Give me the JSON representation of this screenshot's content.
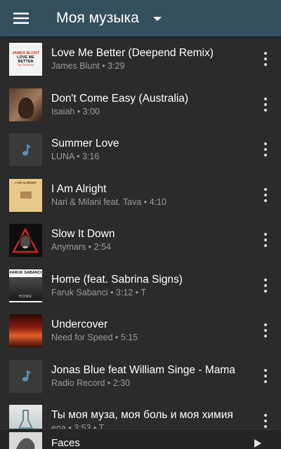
{
  "header": {
    "title": "Моя музыка",
    "menu_icon": "hamburger-menu-icon",
    "dropdown_icon": "caret-down-icon"
  },
  "colors": {
    "toolbar": "#34505f",
    "background": "#2b2b2b",
    "subtitle": "#9a9a9a"
  },
  "tracks": [
    {
      "title": "Love Me Better (Deepend Remix)",
      "subtitle": "James Blunt • 3:29",
      "cover_lines": [
        "JAMES BLUNT",
        "LOVE ME BETTER",
        "THE REMIXES"
      ]
    },
    {
      "title": "Don't Come Easy (Australia)",
      "subtitle": "Isaiah • 3:00"
    },
    {
      "title": "Summer Love",
      "subtitle": "LUNA • 3:16",
      "cover_icon": "music-note-icon"
    },
    {
      "title": "I Am Alright",
      "subtitle": "Nari & Milani feat. Tava  • 4:10",
      "cover_lines": [
        "I AM ALRIGHT"
      ]
    },
    {
      "title": "Slow It Down",
      "subtitle": "Anymars • 2:54"
    },
    {
      "title": "Home (feat. Sabrina Signs)",
      "subtitle": "Faruk Sabanci • 3:12 • T",
      "cover_lines": [
        "FARUK SABANCI",
        "HOME"
      ]
    },
    {
      "title": "Undercover",
      "subtitle": "Need for Speed • 5:15"
    },
    {
      "title": "Jonas Blue feat William Singe - Mama",
      "subtitle": "Radio Record • 2:30",
      "cover_icon": "music-note-icon"
    },
    {
      "title": "Ты моя муза, моя боль и моя химия",
      "subtitle": "ena • 3:53 • T"
    }
  ],
  "player": {
    "title": "Faces",
    "play_icon": "play-icon"
  }
}
